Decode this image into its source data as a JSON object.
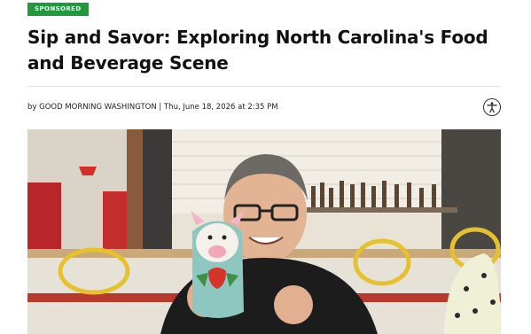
{
  "badge": {
    "label": "SPONSORED",
    "color": "#1e9a3c"
  },
  "article": {
    "title": "Sip and Savor: Exploring North Carolina's Food and Beverage Scene",
    "byline": "by GOOD MORNING WASHINGTON | Thu, June 18, 2026 at 2:35 PM"
  },
  "icons": {
    "accessibility": "accessibility-icon"
  },
  "image": {
    "subject": "photo"
  }
}
